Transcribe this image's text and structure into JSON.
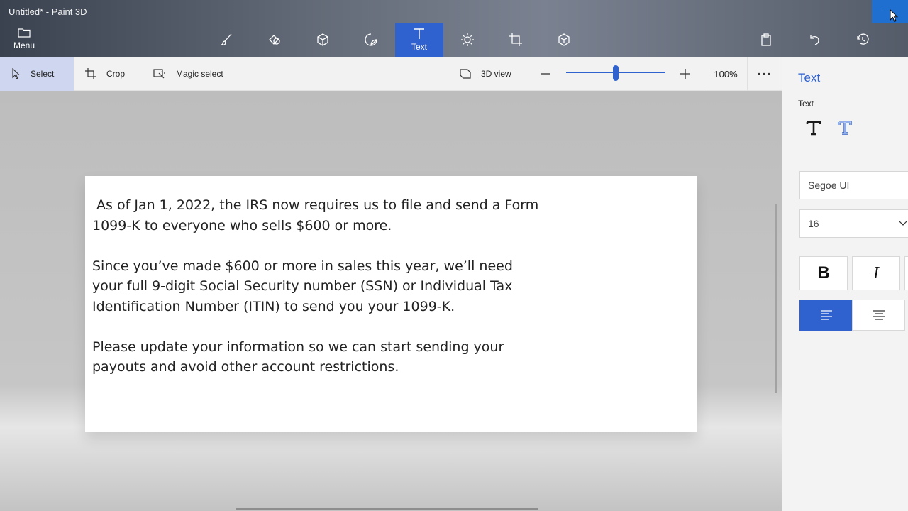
{
  "window": {
    "title": "Untitled* - Paint 3D"
  },
  "topbar": {
    "menu_label": "Menu",
    "tools": [
      {
        "name": "brushes",
        "icon": "brush-icon",
        "label": ""
      },
      {
        "name": "2d-shapes",
        "icon": "2d-shapes-icon",
        "label": ""
      },
      {
        "name": "3d-shapes",
        "icon": "cube-icon",
        "label": ""
      },
      {
        "name": "stickers",
        "icon": "sticker-icon",
        "label": ""
      },
      {
        "name": "text",
        "icon": "text-icon",
        "label": "Text",
        "active": true
      },
      {
        "name": "effects",
        "icon": "sun-icon",
        "label": ""
      },
      {
        "name": "canvas",
        "icon": "canvas-icon",
        "label": ""
      },
      {
        "name": "3d-library",
        "icon": "3d-library-icon",
        "label": ""
      }
    ],
    "right_tools": [
      "paste-icon",
      "undo-icon",
      "history-icon"
    ]
  },
  "subtoolbar": {
    "select_label": "Select",
    "crop_label": "Crop",
    "magic_select_label": "Magic select",
    "view3d_label": "3D view",
    "zoom_value": "100%",
    "zoom_fraction": 0.5
  },
  "canvas": {
    "paragraphs": [
      " As of Jan 1, 2022, the IRS now requires us to file and send a Form 1099-K to everyone who sells $600 or more.",
      "Since you’ve made $600 or more in sales this year, we’ll need your full 9-digit Social Security number (SSN) or Individual Tax Identification Number (ITIN) to send you your 1099-K.",
      "Please update your information so we can start sending your payouts and avoid other account restrictions."
    ]
  },
  "panel": {
    "title": "Text",
    "section_label": "Text",
    "font_family": "Segoe UI",
    "font_size": "16",
    "bold_label": "B",
    "italic_label": "I"
  },
  "colors": {
    "accent": "#2f62cf",
    "minimize_active": "#1f6fd1"
  }
}
